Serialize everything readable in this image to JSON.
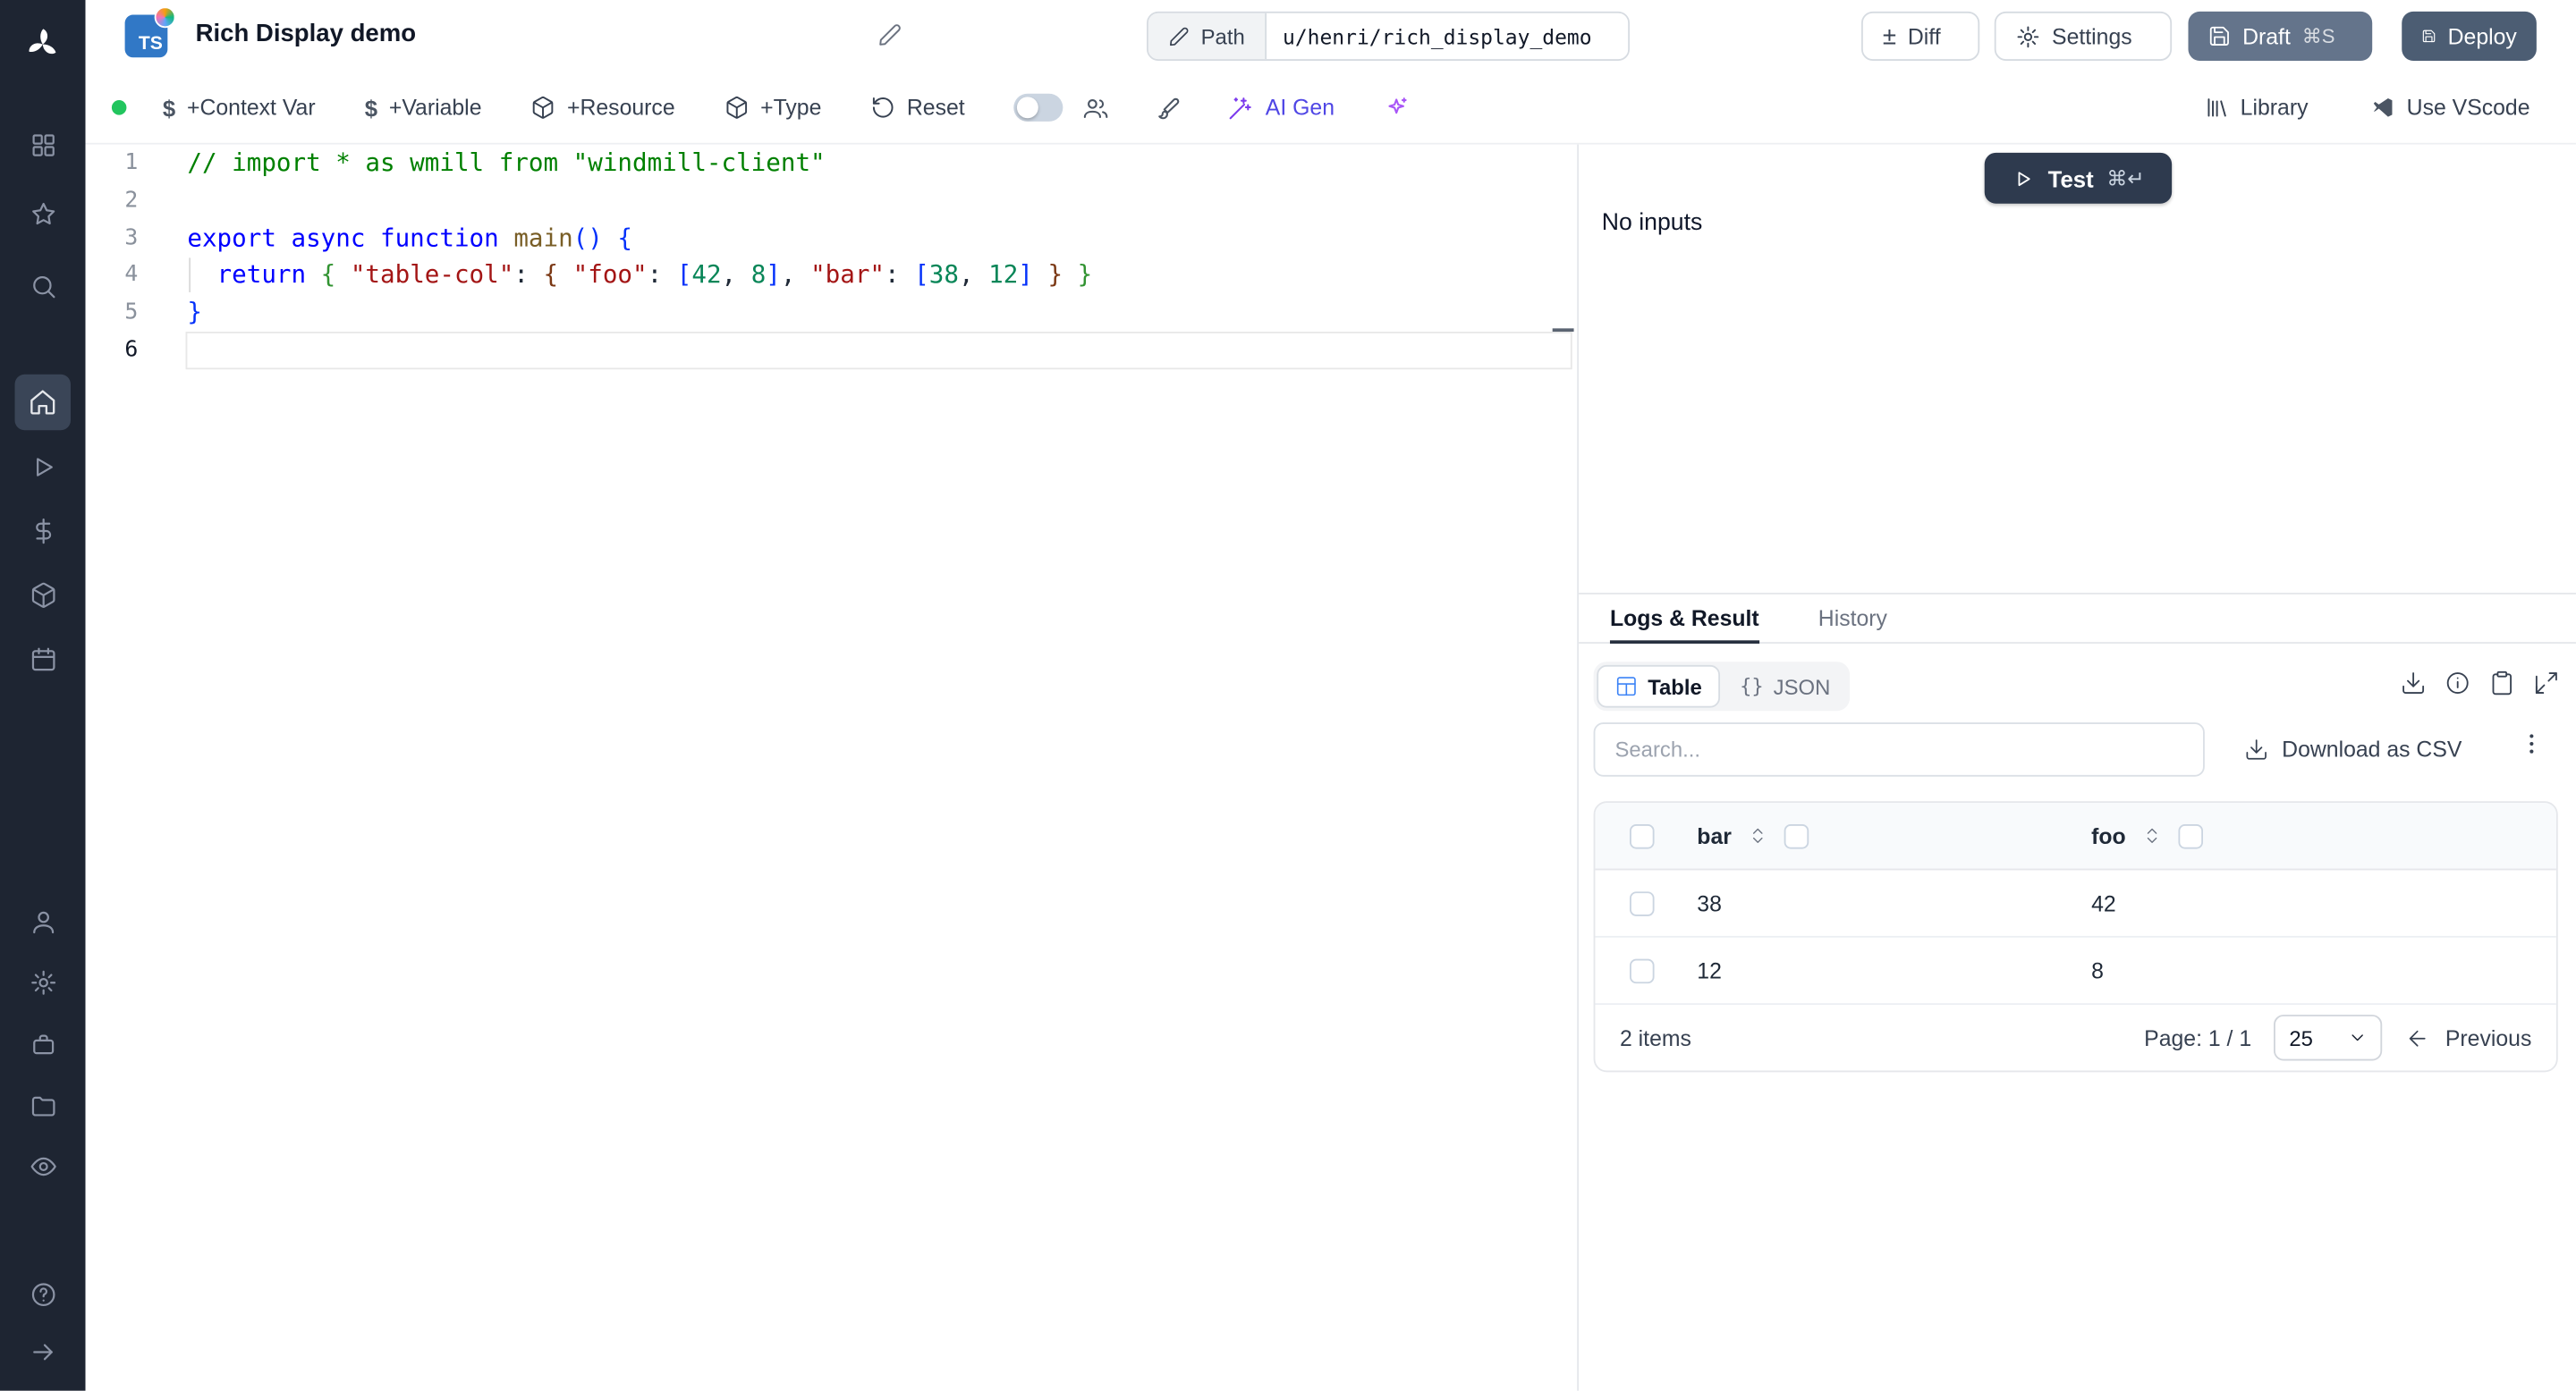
{
  "header": {
    "lang_badge": "TS",
    "title": "Rich Display demo",
    "path_label": "Path",
    "path_value": "u/henri/rich_display_demo",
    "diff_label": "Diff",
    "settings_label": "Settings",
    "draft_label": "Draft",
    "draft_shortcut": "⌘S",
    "deploy_label": "Deploy"
  },
  "toolbar": {
    "context_var": "+Context Var",
    "variable": "+Variable",
    "resource": "+Resource",
    "type": "+Type",
    "reset": "Reset",
    "ai_gen": "AI Gen",
    "library": "Library",
    "vscode": "Use VScode",
    "dollar_glyph": "$",
    "diff_glyph": "±"
  },
  "editor": {
    "active_line": 6,
    "lines": [
      [
        {
          "t": "// import * as wmill from \"windmill-client\"",
          "c": "comment"
        }
      ],
      [],
      [
        {
          "t": "export async function ",
          "c": "kw"
        },
        {
          "t": "main",
          "c": "fn"
        },
        {
          "t": "(",
          "c": "b1"
        },
        {
          "t": ")",
          "c": "b1"
        },
        {
          "t": " ",
          "c": "pl"
        },
        {
          "t": "{",
          "c": "b1"
        }
      ],
      [
        {
          "t": "  ",
          "c": "pl"
        },
        {
          "t": "return",
          "c": "kw"
        },
        {
          "t": " ",
          "c": "pl"
        },
        {
          "t": "{",
          "c": "b2"
        },
        {
          "t": " ",
          "c": "pl"
        },
        {
          "t": "\"table-col\"",
          "c": "str"
        },
        {
          "t": ": ",
          "c": "pl"
        },
        {
          "t": "{",
          "c": "b3"
        },
        {
          "t": " ",
          "c": "pl"
        },
        {
          "t": "\"foo\"",
          "c": "str"
        },
        {
          "t": ": ",
          "c": "pl"
        },
        {
          "t": "[",
          "c": "b1"
        },
        {
          "t": "42",
          "c": "num"
        },
        {
          "t": ", ",
          "c": "pl"
        },
        {
          "t": "8",
          "c": "num"
        },
        {
          "t": "]",
          "c": "b1"
        },
        {
          "t": ", ",
          "c": "pl"
        },
        {
          "t": "\"bar\"",
          "c": "str"
        },
        {
          "t": ": ",
          "c": "pl"
        },
        {
          "t": "[",
          "c": "b1"
        },
        {
          "t": "38",
          "c": "num"
        },
        {
          "t": ", ",
          "c": "pl"
        },
        {
          "t": "12",
          "c": "num"
        },
        {
          "t": "]",
          "c": "b1"
        },
        {
          "t": " ",
          "c": "pl"
        },
        {
          "t": "}",
          "c": "b3"
        },
        {
          "t": " ",
          "c": "pl"
        },
        {
          "t": "}",
          "c": "b2"
        }
      ],
      [
        {
          "t": "}",
          "c": "b1"
        }
      ],
      []
    ]
  },
  "run": {
    "test_label": "Test",
    "test_shortcut": "⌘↵",
    "no_inputs": "No inputs",
    "tab_logs": "Logs & Result",
    "tab_history": "History",
    "table_view": "Table",
    "json_view": "JSON",
    "json_braces": "{}",
    "search_placeholder": "Search...",
    "download_csv": "Download as CSV"
  },
  "table": {
    "columns": [
      "bar",
      "foo"
    ],
    "rows": [
      [
        "38",
        "42"
      ],
      [
        "12",
        "8"
      ]
    ],
    "items_count": "2 items",
    "page_label": "Page: 1 / 1",
    "page_size": "25",
    "previous": "Previous"
  },
  "sidebar": {
    "items": [
      "apps",
      "favorites",
      "search",
      "home",
      "runs",
      "variables",
      "resources",
      "schedules",
      "users",
      "settings",
      "workers",
      "folders",
      "audit-logs",
      "help",
      "collapse"
    ]
  },
  "icons": {
    "windmill-logo": "pinwheel",
    "edit": "pencil",
    "diff": "±",
    "settings": "gear",
    "save": "floppy",
    "test": "play",
    "table-view": "grid",
    "download": "arrow-down-tray",
    "info": "circle-i",
    "copy": "clipboard",
    "expand": "maximize",
    "kebab": "vertical-dots",
    "sort": "chevrons-up-down"
  },
  "colors": {
    "sidebar_bg": "#1e2532",
    "ts_blue": "#3178c6",
    "status_green": "#22c55e",
    "test_button": "#2e3a4e",
    "draft_button": "#64748b",
    "deploy_button": "#4c5d73",
    "ai_accent": "#4f46e5"
  }
}
